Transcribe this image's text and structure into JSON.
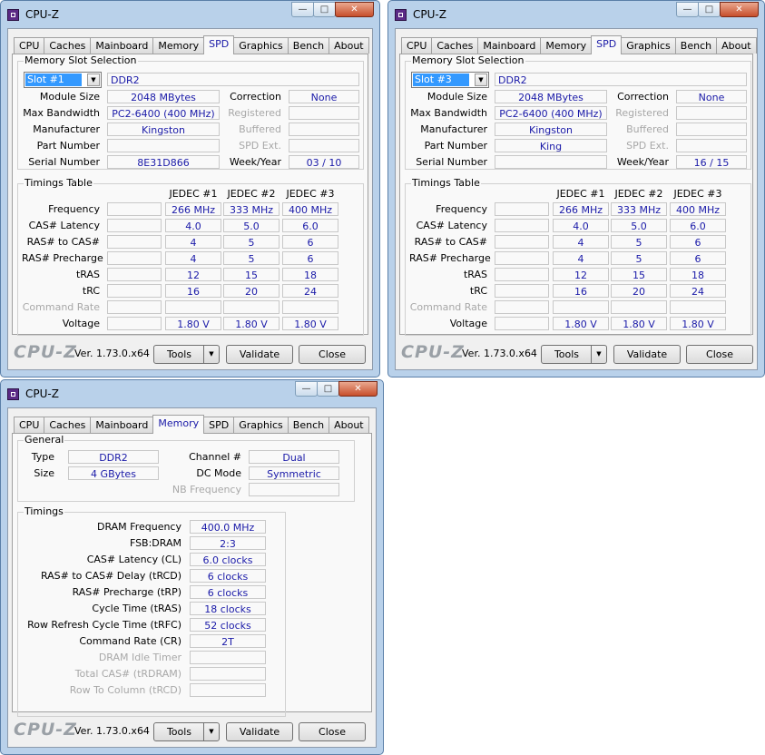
{
  "window": {
    "title": "CPU-Z",
    "tabs": [
      "CPU",
      "Caches",
      "Mainboard",
      "Memory",
      "SPD",
      "Graphics",
      "Bench",
      "About"
    ],
    "brand": "CPU-Z",
    "version": "Ver. 1.73.0.x64",
    "buttons": {
      "tools": "Tools",
      "validate": "Validate",
      "close": "Close"
    }
  },
  "spd_labels": {
    "slot_group": "Memory Slot Selection",
    "module_size": "Module Size",
    "max_bandwidth": "Max Bandwidth",
    "manufacturer": "Manufacturer",
    "part_number": "Part Number",
    "serial_number": "Serial Number",
    "correction": "Correction",
    "registered": "Registered",
    "buffered": "Buffered",
    "spd_ext": "SPD Ext.",
    "week_year": "Week/Year",
    "timings_group": "Timings Table",
    "columns": [
      "JEDEC #1",
      "JEDEC #2",
      "JEDEC #3"
    ],
    "rows": [
      "Frequency",
      "CAS# Latency",
      "RAS# to CAS#",
      "RAS# Precharge",
      "tRAS",
      "tRC",
      "Command Rate",
      "Voltage"
    ]
  },
  "spd1": {
    "slot": "Slot #1",
    "type": "DDR2",
    "module_size": "2048 MBytes",
    "max_bandwidth": "PC2-6400 (400 MHz)",
    "manufacturer": "Kingston",
    "part_number": "",
    "serial_number": "8E31D866",
    "correction": "None",
    "week_year": "03 / 10",
    "jedec": {
      "frequency": [
        "266 MHz",
        "333 MHz",
        "400 MHz"
      ],
      "cas": [
        "4.0",
        "5.0",
        "6.0"
      ],
      "ras_cas": [
        "4",
        "5",
        "6"
      ],
      "ras_pre": [
        "4",
        "5",
        "6"
      ],
      "tras": [
        "12",
        "15",
        "18"
      ],
      "trc": [
        "16",
        "20",
        "24"
      ],
      "voltage": [
        "1.80 V",
        "1.80 V",
        "1.80 V"
      ]
    }
  },
  "spd3": {
    "slot": "Slot #3",
    "type": "DDR2",
    "module_size": "2048 MBytes",
    "max_bandwidth": "PC2-6400 (400 MHz)",
    "manufacturer": "Kingston",
    "part_number": "King",
    "serial_number": "",
    "correction": "None",
    "week_year": "16 / 15",
    "jedec": {
      "frequency": [
        "266 MHz",
        "333 MHz",
        "400 MHz"
      ],
      "cas": [
        "4.0",
        "5.0",
        "6.0"
      ],
      "ras_cas": [
        "4",
        "5",
        "6"
      ],
      "ras_pre": [
        "4",
        "5",
        "6"
      ],
      "tras": [
        "12",
        "15",
        "18"
      ],
      "trc": [
        "16",
        "20",
        "24"
      ],
      "voltage": [
        "1.80 V",
        "1.80 V",
        "1.80 V"
      ]
    }
  },
  "memory": {
    "general_group": "General",
    "type_label": "Type",
    "type": "DDR2",
    "size_label": "Size",
    "size": "4 GBytes",
    "channel_label": "Channel #",
    "channel": "Dual",
    "dc_mode_label": "DC Mode",
    "dc_mode": "Symmetric",
    "nb_freq_label": "NB Frequency",
    "timings_group": "Timings",
    "timings": [
      {
        "label": "DRAM Frequency",
        "value": "400.0 MHz"
      },
      {
        "label": "FSB:DRAM",
        "value": "2:3"
      },
      {
        "label": "CAS# Latency (CL)",
        "value": "6.0 clocks"
      },
      {
        "label": "RAS# to CAS# Delay (tRCD)",
        "value": "6 clocks"
      },
      {
        "label": "RAS# Precharge (tRP)",
        "value": "6 clocks"
      },
      {
        "label": "Cycle Time (tRAS)",
        "value": "18 clocks"
      },
      {
        "label": "Row Refresh Cycle Time (tRFC)",
        "value": "52 clocks"
      },
      {
        "label": "Command Rate (CR)",
        "value": "2T"
      },
      {
        "label": "DRAM Idle Timer",
        "value": ""
      },
      {
        "label": "Total CAS# (tRDRAM)",
        "value": ""
      },
      {
        "label": "Row To Column (tRCD)",
        "value": ""
      }
    ]
  }
}
